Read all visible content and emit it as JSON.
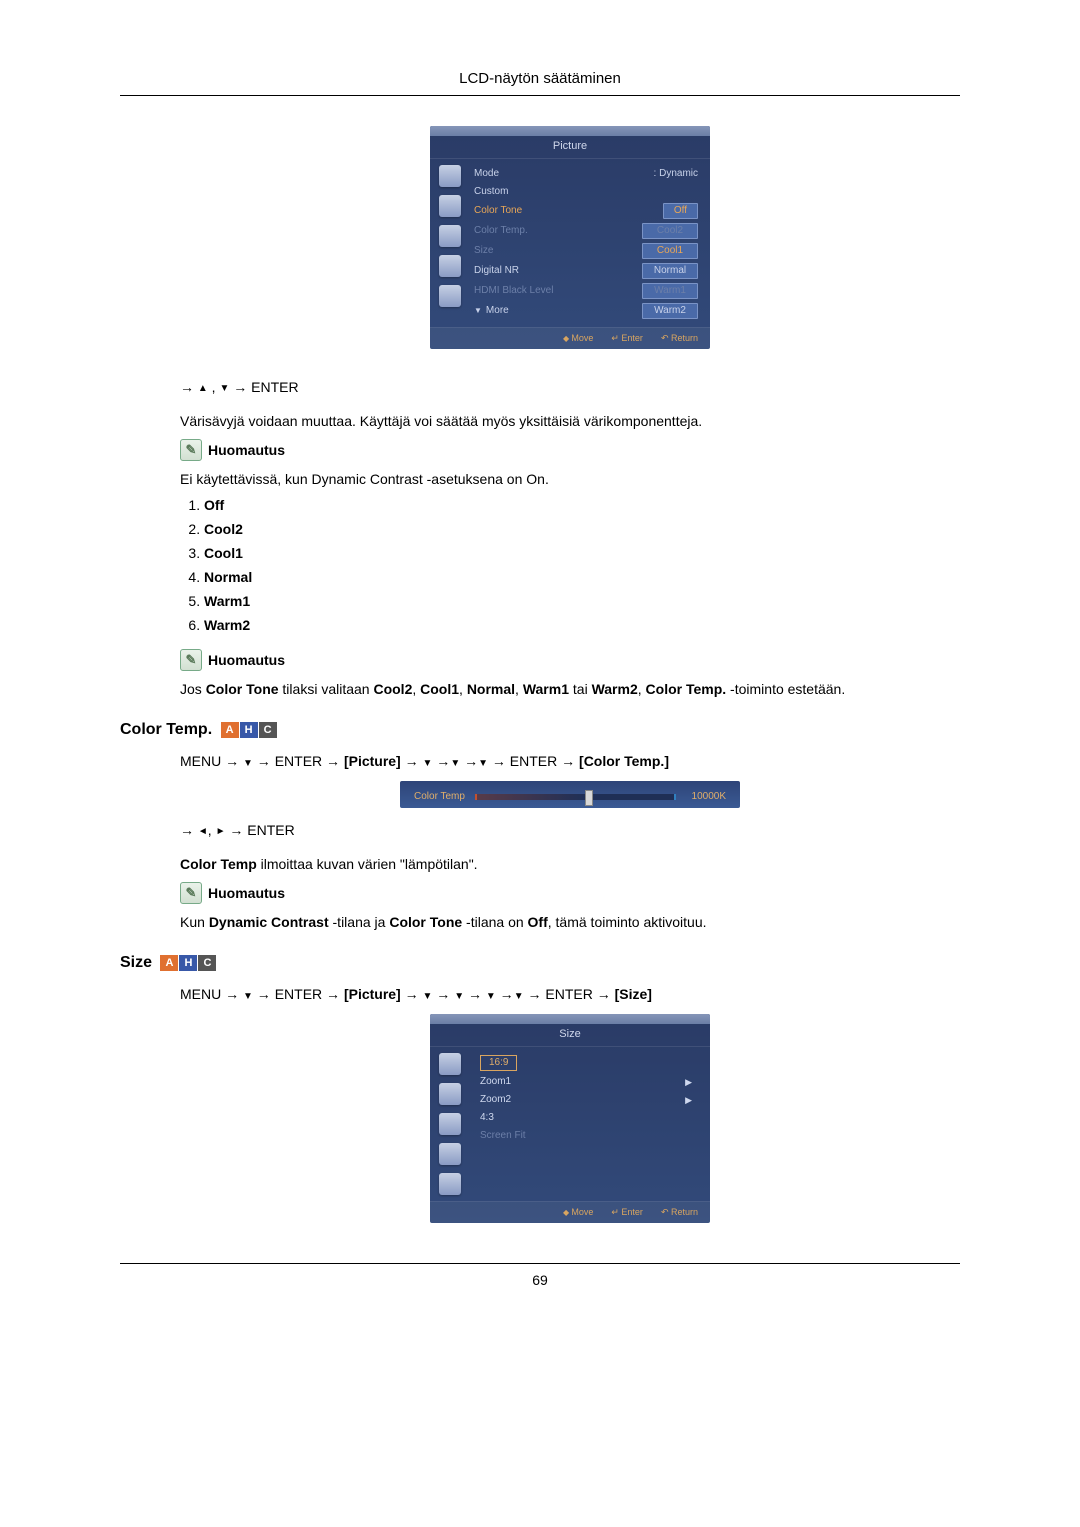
{
  "header": {
    "title": "LCD-näytön säätäminen"
  },
  "osd_picture": {
    "title": "Picture",
    "rows": [
      {
        "label": "Mode",
        "value": ": Dynamic",
        "style": "plain"
      },
      {
        "label": "Custom",
        "value": "",
        "style": "plain"
      },
      {
        "label": "Color Tone",
        "value": "Off",
        "style": "highlight"
      },
      {
        "label": "Color Temp.",
        "value": "Cool2",
        "style": "dim box"
      },
      {
        "label": "Size",
        "value": "Cool1",
        "style": "dim box"
      },
      {
        "label": "Digital NR",
        "value": "Normal",
        "style": "box"
      },
      {
        "label": "HDMI Black Level",
        "value": "Warm1",
        "style": "dim box"
      },
      {
        "label": "More",
        "value": "Warm2",
        "style": "more box"
      }
    ],
    "footer": {
      "move": "Move",
      "enter": "Enter",
      "ret": "Return"
    }
  },
  "nav1": {
    "enter": "ENTER"
  },
  "para1": "Värisävyjä voidaan muuttaa. Käyttäjä voi säätää myös yksittäisiä värikomponentteja.",
  "note_label": "Huomautus",
  "para2": "Ei käytettävissä, kun Dynamic Contrast -asetuksena on On.",
  "tone_list": [
    "Off",
    "Cool2",
    "Cool1",
    "Normal",
    "Warm1",
    "Warm2"
  ],
  "para3_parts": {
    "p1": "Jos ",
    "b1": "Color Tone",
    "p2": " tilaksi valitaan ",
    "b2": "Cool2",
    "c": ", ",
    "b3": "Cool1",
    "b4": "Normal",
    "b5": "Warm1",
    "p3": " tai ",
    "b6": "Warm2",
    "b7": "Color Temp.",
    "p4": " -toiminto estetään."
  },
  "sec_color_temp": "Color Temp.",
  "menu_path_ct": {
    "menu": "MENU",
    "enter": "ENTER",
    "picture": "[Picture]",
    "target": "[Color Temp.]"
  },
  "temp_osd": {
    "label": "Color Temp",
    "value": "10000K"
  },
  "nav2": {
    "enter": "ENTER"
  },
  "para_ct1_parts": {
    "b": "Color Temp",
    "t": " ilmoittaa kuvan värien \"lämpötilan\"."
  },
  "para_ct2_parts": {
    "p1": "Kun ",
    "b1": "Dynamic Contrast",
    "p2": " -tilana ja ",
    "b2": "Color Tone",
    "p3": " -tilana on ",
    "b3": "Off",
    "p4": ", tämä toiminto aktivoituu."
  },
  "sec_size": "Size",
  "menu_path_size": {
    "menu": "MENU",
    "enter": "ENTER",
    "picture": "[Picture]",
    "target": "[Size]"
  },
  "osd_size": {
    "title": "Size",
    "rows": [
      {
        "label": "16:9",
        "arrow": "",
        "sel": true
      },
      {
        "label": "Zoom1",
        "arrow": "▶"
      },
      {
        "label": "Zoom2",
        "arrow": "▶"
      },
      {
        "label": "4:3",
        "arrow": ""
      },
      {
        "label": "Screen Fit",
        "arrow": "",
        "dim": true
      }
    ],
    "footer": {
      "move": "Move",
      "enter": "Enter",
      "ret": "Return"
    }
  },
  "page_number": "69"
}
